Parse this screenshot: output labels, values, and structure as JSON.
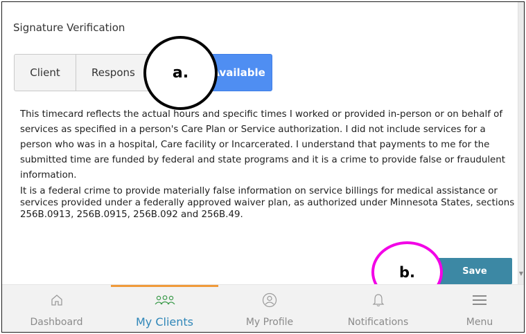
{
  "section": {
    "title": "Signature Verification"
  },
  "segmented": [
    {
      "label": "Client",
      "selected": false
    },
    {
      "label": "Respons",
      "selected": false
    },
    {
      "label": "Not Available",
      "selected": true
    }
  ],
  "attestation": {
    "paragraph1": "This timecard reflects the actual hours and specific times I worked or provided in-person or on behalf of services as specified in a person's Care Plan or Service authorization. I did not include services for a person who was in a hospital, Care facility or Incarcerated. I understand that payments to me for the submitted time are funded by federal and state programs and it is a crime to provide false or fraudulent information.",
    "paragraph2": "It is a federal crime to provide materially false information on service billings for medical assistance or services provided under a federally approved waiver plan, as authorized under Minnesota States, sections 256B.0913, 256B.0915, 256B.092 and 256B.49."
  },
  "save_label": "Save",
  "callouts": {
    "a": "a.",
    "b": "b."
  },
  "nav": [
    {
      "label": "Dashboard",
      "icon": "home-icon",
      "active": false
    },
    {
      "label": "My Clients",
      "icon": "clients-icon",
      "active": true
    },
    {
      "label": "My Profile",
      "icon": "profile-icon",
      "active": false
    },
    {
      "label": "Notifications",
      "icon": "bell-icon",
      "active": false
    },
    {
      "label": "Menu",
      "icon": "hamburger-menu-icon",
      "active": false
    }
  ],
  "colors": {
    "selected_segment": "#4f8ef2",
    "save_button": "#3c88a4",
    "active_nav_text": "#2f86b8",
    "active_nav_indicator": "#f09a3a",
    "callout_a_ring": "#000000",
    "callout_b_ring": "#f200e6"
  }
}
